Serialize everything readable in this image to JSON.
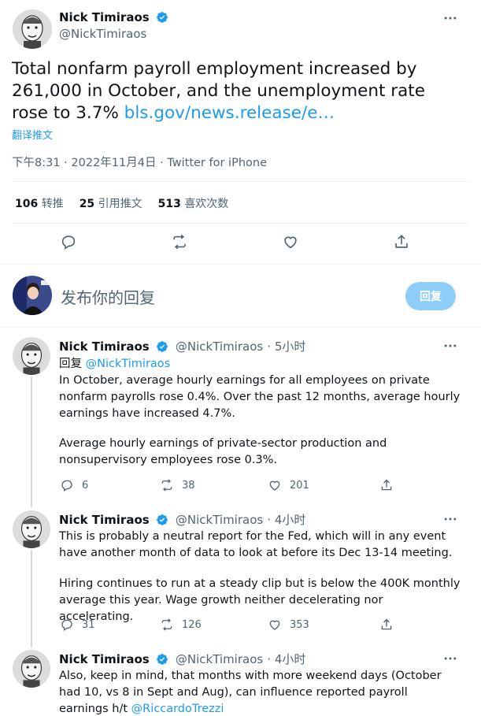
{
  "main_tweet": {
    "author_name": "Nick Timiraos",
    "author_handle": "@NickTimiraos",
    "text_part1": "Total nonfarm payroll employment increased by 261,000 in October, and the unemployment rate rose to 3.7%",
    "link_text": "bls.gov/news.release/e…",
    "translate_label": "翻译推文",
    "timestamp": "下午8:31 · 2022年11月4日 · Twitter for iPhone",
    "stats": [
      {
        "value": "106",
        "label": "转推"
      },
      {
        "value": "25",
        "label": "引用推文"
      },
      {
        "value": "513",
        "label": "喜欢次数"
      }
    ]
  },
  "compose": {
    "placeholder": "发布你的回复",
    "button_label": "回复"
  },
  "replies": [
    {
      "author_name": "Nick Timiraos",
      "author_handle": "@NickTimiraos",
      "time": "5小时",
      "reply_to_prefix": "回复",
      "reply_to_handle": "@NickTimiraos",
      "text": "In October, average hourly earnings for all employees on private nonfarm payrolls rose 0.4%. Over the past 12 months, average hourly earnings have increased 4.7%.",
      "text2": "Average hourly earnings of private-sector production and nonsupervisory employees rose 0.3%.",
      "replies": "6",
      "retweets": "38",
      "likes": "201"
    },
    {
      "author_name": "Nick Timiraos",
      "author_handle": "@NickTimiraos",
      "time": "4小时",
      "text": "This is probably a neutral report for the Fed, which will in any event have another month of data to look at before its Dec 13-14 meeting.",
      "text2": "Hiring continues to run at a steady clip but is below the 400K monthly average this year. Wage growth neither decelerating nor accelerating.",
      "replies": "31",
      "retweets": "126",
      "likes": "353"
    },
    {
      "author_name": "Nick Timiraos",
      "author_handle": "@NickTimiraos",
      "time": "4小时",
      "text": "Also, keep in mind, that months with more weekend days (October had 10, vs 8 in Sept and Aug), can influence reported payroll earnings h/t",
      "mention": "@RiccardoTrezzi"
    }
  ],
  "colors": {
    "accent": "#1d9bf0",
    "muted": "#536471",
    "reply_button_bg": "#8ecdf7",
    "divider": "#eff3f4"
  }
}
